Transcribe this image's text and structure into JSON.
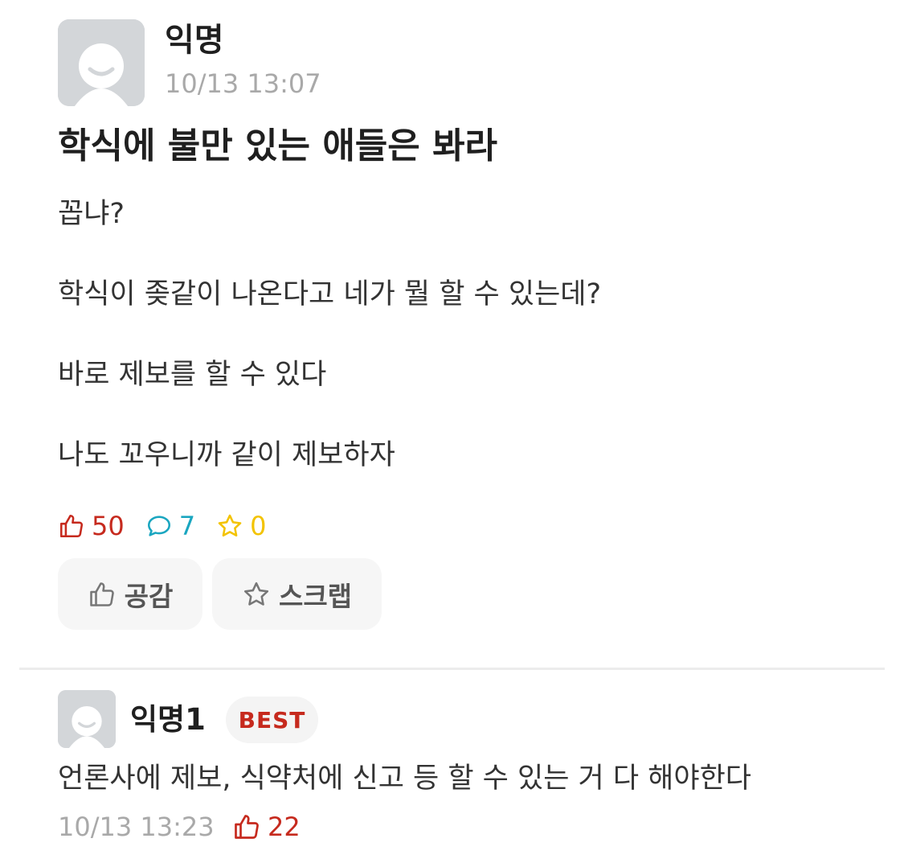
{
  "post": {
    "author": "익명",
    "datetime": "10/13 13:07",
    "title": "학식에 불만 있는 애들은 봐라",
    "body": [
      "꼽냐?",
      "학식이 좆같이 나온다고 네가 뭘 할 수 있는데?",
      "바로 제보를 할 수 있다",
      "나도 꼬우니까 같이 제보하자"
    ],
    "stats": {
      "likes": "50",
      "comments": "7",
      "scraps": "0"
    },
    "buttons": {
      "like_label": "공감",
      "scrap_label": "스크랩"
    }
  },
  "comment": {
    "author": "익명1",
    "badge": "BEST",
    "text": "언론사에 제보, 식약처에 신고 등 할 수 있는 거 다 해야한다",
    "datetime": "10/13 13:23",
    "likes": "22"
  },
  "colors": {
    "like": "#c62a1e",
    "comment": "#1aa6c0",
    "scrap": "#f3c300",
    "muted": "#a9a9a9"
  },
  "icons": {
    "avatar": "anonymous-avatar-icon",
    "like": "thumbs-up-icon",
    "comment": "speech-bubble-icon",
    "scrap": "star-icon"
  }
}
